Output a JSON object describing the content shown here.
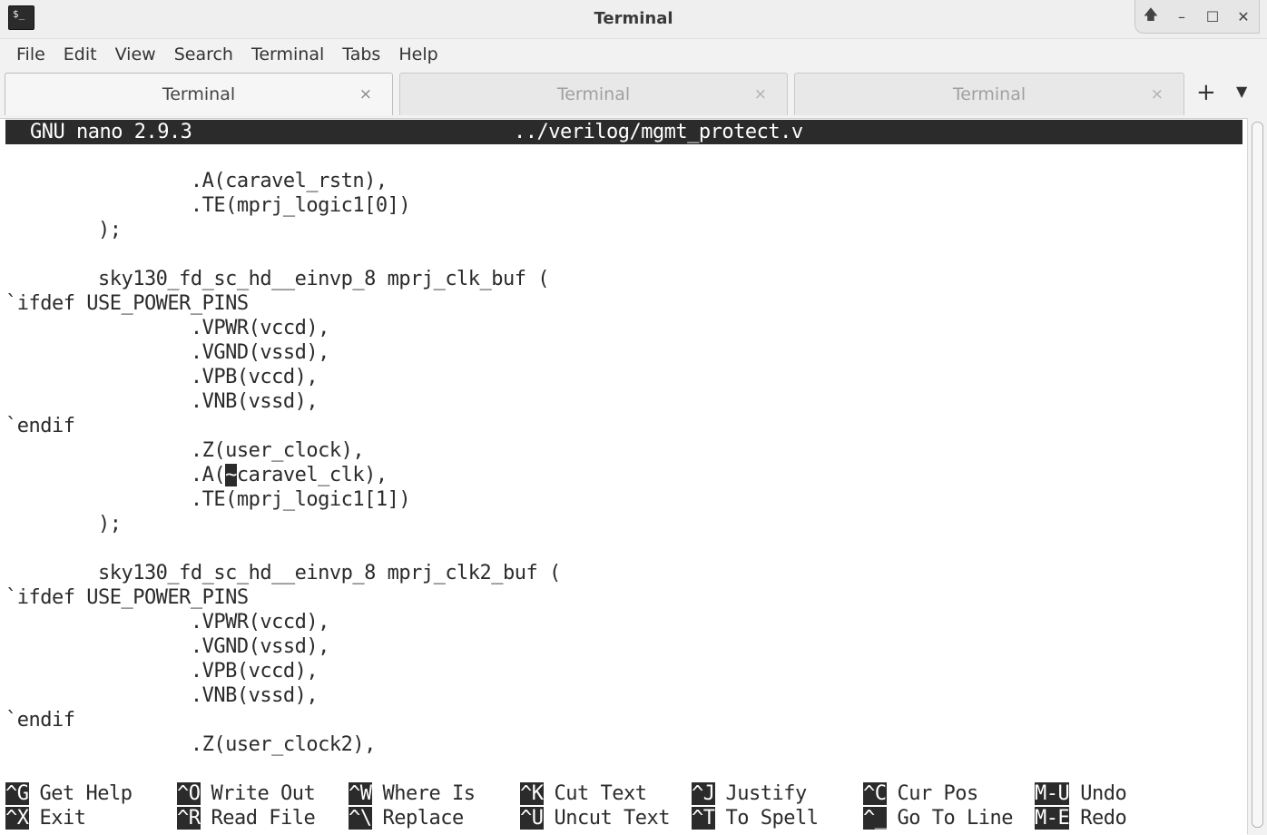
{
  "window": {
    "title": "Terminal",
    "app_icon_text": "$_",
    "controls": [
      "🡅",
      "–",
      "☐",
      "✕"
    ]
  },
  "menubar": [
    "File",
    "Edit",
    "View",
    "Search",
    "Terminal",
    "Tabs",
    "Help"
  ],
  "tabs": [
    {
      "label": "Terminal",
      "close": "×",
      "active": true
    },
    {
      "label": "Terminal",
      "close": "×",
      "active": false
    },
    {
      "label": "Terminal",
      "close": "×",
      "active": false
    }
  ],
  "tab_add": "+",
  "tab_menu": "▼",
  "editor": {
    "version": "GNU nano 2.9.3",
    "filename": "../verilog/mgmt_protect.v",
    "lines": [
      "                .A(caravel_rstn),",
      "                .TE(mprj_logic1[0])",
      "        );",
      "",
      "        sky130_fd_sc_hd__einvp_8 mprj_clk_buf (",
      "`ifdef USE_POWER_PINS",
      "                .VPWR(vccd),",
      "                .VGND(vssd),",
      "                .VPB(vccd),",
      "                .VNB(vssd),",
      "`endif",
      "                .Z(user_clock),",
      "                .A(~caravel_clk),",
      "                .TE(mprj_logic1[1])",
      "        );",
      "",
      "        sky130_fd_sc_hd__einvp_8 mprj_clk2_buf (",
      "`ifdef USE_POWER_PINS",
      "                .VPWR(vccd),",
      "                .VGND(vssd),",
      "                .VPB(vccd),",
      "                .VNB(vssd),",
      "`endif",
      "                .Z(user_clock2),"
    ],
    "cursor_line_index": 12,
    "cursor_char": "~"
  },
  "shortcuts": [
    [
      {
        "key": "^G",
        "label": "Get Help"
      },
      {
        "key": "^O",
        "label": "Write Out"
      },
      {
        "key": "^W",
        "label": "Where Is"
      },
      {
        "key": "^K",
        "label": "Cut Text"
      },
      {
        "key": "^J",
        "label": "Justify"
      },
      {
        "key": "^C",
        "label": "Cur Pos"
      },
      {
        "key": "M-U",
        "label": "Undo"
      }
    ],
    [
      {
        "key": "^X",
        "label": "Exit"
      },
      {
        "key": "^R",
        "label": "Read File"
      },
      {
        "key": "^\\",
        "label": "Replace"
      },
      {
        "key": "^U",
        "label": "Uncut Text"
      },
      {
        "key": "^T",
        "label": "To Spell"
      },
      {
        "key": "^_",
        "label": "Go To Line"
      },
      {
        "key": "M-E",
        "label": "Redo"
      }
    ]
  ]
}
